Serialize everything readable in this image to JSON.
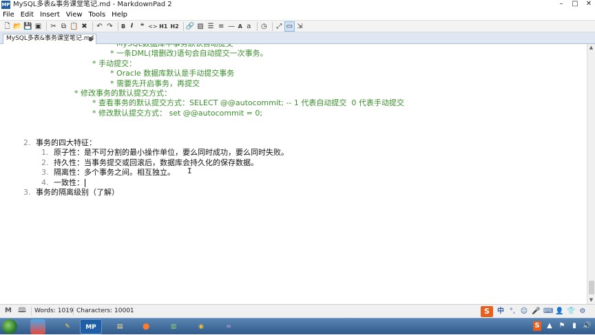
{
  "window": {
    "app_icon": "MP",
    "title": "MySQL多表&事务课堂笔记.md - MarkdownPad 2",
    "controls": [
      "minimize-icon",
      "maximize-icon",
      "close-icon"
    ]
  },
  "menu": [
    "File",
    "Edit",
    "Insert",
    "View",
    "Tools",
    "Help"
  ],
  "toolbar": {
    "h1": "H1",
    "h2": "H2",
    "lower_a": "a",
    "upper_a": "A",
    "icons": [
      "new-file-icon",
      "open-folder-icon",
      "save-icon",
      "save-all-icon",
      "cut-icon",
      "copy-icon",
      "paste-icon",
      "delete-icon",
      "undo-icon",
      "redo-icon",
      "bold-icon",
      "italic-icon",
      "quote-icon",
      "code-icon",
      "link-icon",
      "image-icon",
      "ordered-list-icon",
      "unordered-list-icon",
      "horizontal-rule-icon",
      "timestamp-icon",
      "sync-scroll-icon",
      "preview-icon",
      "export-icon"
    ]
  },
  "tab": {
    "label": "MySQL多表&事务课堂笔记.md",
    "modified_marker": "●"
  },
  "editor": {
    "lines": [
      {
        "indent": "            ",
        "text": "* MySQL数据库中事务默认自动提交",
        "style": "g"
      },
      {
        "indent": "            ",
        "text": "* 一条DML(增删改)语句会自动提交一次事务。",
        "style": "g"
      },
      {
        "indent": "        ",
        "text": "* 手动提交：",
        "style": "g"
      },
      {
        "indent": "            ",
        "text": "* Oracle 数据库默认是手动提交事务",
        "style": "g"
      },
      {
        "indent": "            ",
        "text": "* 需要先开启事务，再提交",
        "style": "g"
      },
      {
        "indent": "    ",
        "text": "* 修改事务的默认提交方式：",
        "style": "g"
      },
      {
        "indent": "        ",
        "text": "* 查看事务的默认提交方式：SELECT @@autocommit; -- 1 代表自动提交  0 代表手动提交",
        "style": "g"
      },
      {
        "indent": "        ",
        "text": "* 修改默认提交方式： set @@autocommit = 0;",
        "style": "g"
      },
      {
        "indent": "",
        "text": "",
        "style": "k"
      },
      {
        "indent": "",
        "text": "",
        "style": "k"
      },
      {
        "indent": "",
        "num": "2.",
        "text": "事务的四大特征：",
        "style": "k"
      },
      {
        "indent": "    ",
        "num": "1.",
        "text": "原子性：是不可分割的最小操作单位，要么同时成功，要么同时失败。",
        "style": "k"
      },
      {
        "indent": "    ",
        "num": "2.",
        "text": "持久性：当事务提交或回滚后，数据库会持久化的保存数据。",
        "style": "k"
      },
      {
        "indent": "    ",
        "num": "3.",
        "text": "隔离性：多个事务之间。相互独立。",
        "style": "k"
      },
      {
        "indent": "    ",
        "num": "4.",
        "text": "一致性：",
        "style": "k",
        "cursor": true
      },
      {
        "indent": "",
        "num": "3.",
        "text": "事务的隔离级别（了解）",
        "style": "k"
      }
    ]
  },
  "status": {
    "words": "Words: 1019",
    "characters": "Characters: 10001",
    "left_icons": [
      "markdown-icon",
      "book-icon"
    ],
    "ime_label": "S",
    "ime_mode": "中",
    "ime_icons": [
      "punctuation-icon",
      "emoji-icon",
      "microphone-icon",
      "keyboard-icon",
      "user-icon",
      "shirt-icon",
      "tools-icon"
    ]
  },
  "taskbar": {
    "apps": [
      {
        "name": "explorer",
        "label": ""
      },
      {
        "name": "media",
        "label": ""
      },
      {
        "name": "tool",
        "label": ""
      },
      {
        "name": "markdownpad",
        "label": "MP"
      },
      {
        "name": "files",
        "label": ""
      },
      {
        "name": "pdf",
        "label": ""
      },
      {
        "name": "chart",
        "label": ""
      },
      {
        "name": "chrome",
        "label": ""
      },
      {
        "name": "visual-studio",
        "label": ""
      }
    ],
    "tray_ime": "S"
  },
  "colors": {
    "list_green": "#3a8e2b",
    "tab_bar": "#dfe8f2",
    "ime_orange": "#e8601d",
    "taskbar_blue": "#2f5a8a"
  }
}
